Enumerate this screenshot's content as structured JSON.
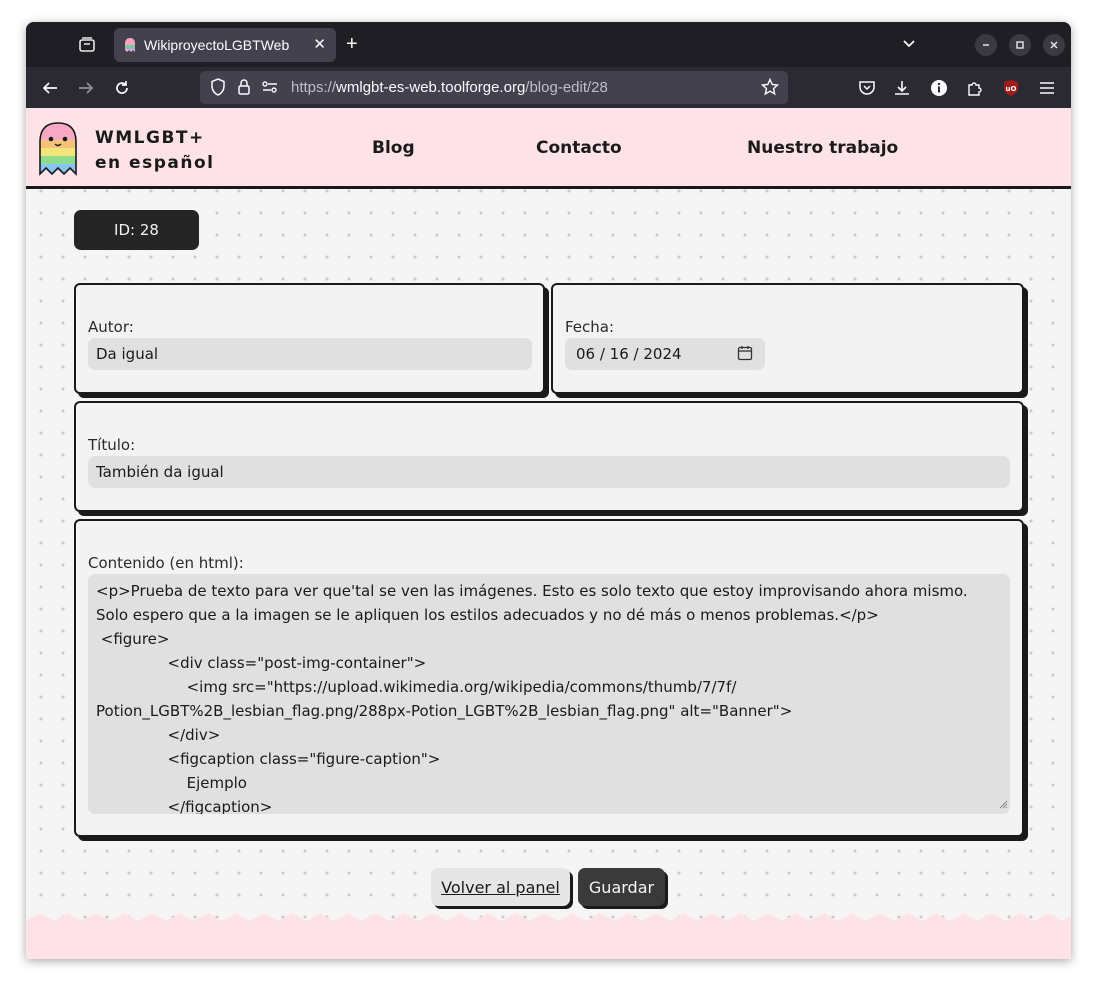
{
  "browser": {
    "tab_title": "WikiproyectoLGBTWeb",
    "tab_close": "✕",
    "new_tab": "+",
    "url_scheme": "https://",
    "url_host": "wmlgbt-es-web.toolforge.org",
    "url_path": "/blog-edit/28"
  },
  "site": {
    "brand_line1": "WMLGBT+",
    "brand_line2": "en español",
    "menu": {
      "blog": "Blog",
      "contact": "Contacto",
      "work": "Nuestro trabajo"
    }
  },
  "form": {
    "id_label": "ID: 28",
    "author_label": "Autor:",
    "author_value": "Da igual",
    "date_label": "Fecha:",
    "date_value": "06 / 16 / 2024",
    "title_label": "Título:",
    "title_value": "También da igual",
    "content_label": "Contenido (en html):",
    "content_value": "<p>Prueba de texto para ver que'tal se ven las imágenes. Esto es solo texto que estoy improvisando ahora mismo.\nSolo espero que a la imagen se le apliquen los estilos adecuados y no dé más o menos problemas.</p>\n <figure>\n               <div class=\"post-img-container\">\n                   <img src=\"https://upload.wikimedia.org/wikipedia/commons/thumb/7/7f/\nPotion_LGBT%2B_lesbian_flag.png/288px-Potion_LGBT%2B_lesbian_flag.png\" alt=\"Banner\">\n               </div>\n               <figcaption class=\"figure-caption\">\n                   Ejemplo\n               </figcaption>\n </figure>",
    "back_button": "Volver al panel",
    "save_button": "Guardar"
  }
}
